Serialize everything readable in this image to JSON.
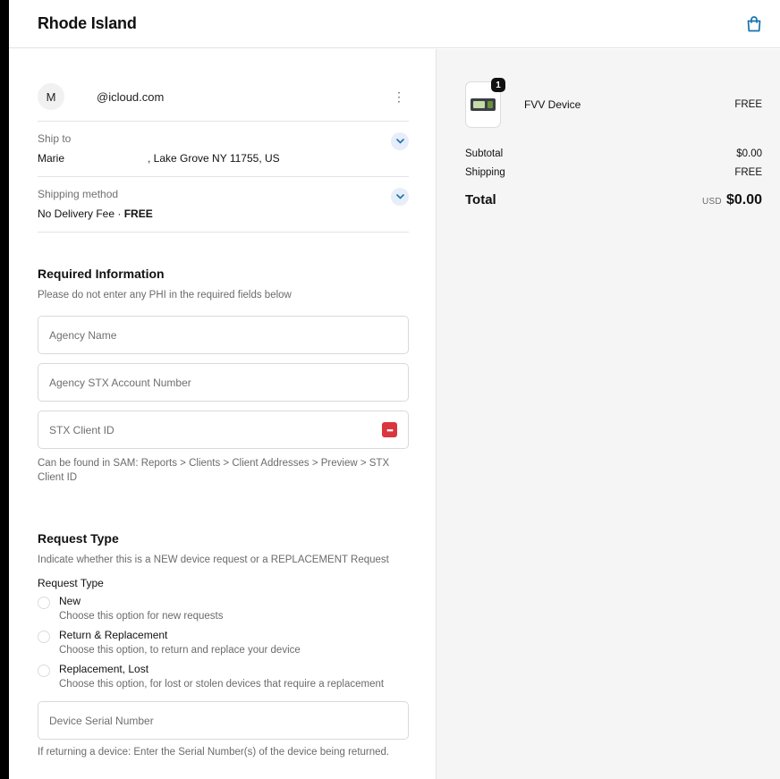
{
  "header": {
    "store_name": "Rhode Island",
    "cart_icon": "shopping-bag-icon"
  },
  "contact": {
    "avatar_initial": "M",
    "email": "@icloud.com",
    "menu_icon": "more-vertical-icon"
  },
  "ship_to": {
    "label": "Ship to",
    "name": "Marie",
    "address": ", Lake Grove NY 11755, US"
  },
  "shipping_method": {
    "label": "Shipping method",
    "value": "No Delivery Fee · ",
    "price": "FREE"
  },
  "required_info": {
    "title": "Required Information",
    "subtitle": "Please do not enter any PHI in the required fields below",
    "fields": [
      {
        "placeholder": "Agency Name"
      },
      {
        "placeholder": "Agency STX Account Number"
      },
      {
        "placeholder": "STX Client ID"
      }
    ],
    "client_id_help": "Can be found in SAM: Reports > Clients > Client Addresses > Preview > STX Client ID"
  },
  "request_type": {
    "title": "Request Type",
    "subtitle": "Indicate whether this is a NEW device request or a REPLACEMENT Request",
    "group_label": "Request Type",
    "options": [
      {
        "label": "New",
        "description": "Choose this option for new requests"
      },
      {
        "label": "Return & Replacement",
        "description": "Choose this option, to return and replace your device"
      },
      {
        "label": "Replacement, Lost",
        "description": "Choose this option, for lost or stolen devices that require a replacement"
      }
    ],
    "serial_placeholder": "Device Serial Number",
    "serial_help": "If returning a device: Enter the Serial Number(s) of the device being returned."
  },
  "summary": {
    "item": {
      "name": "FVV Device",
      "price": "FREE",
      "quantity": "1"
    },
    "subtotal_label": "Subtotal",
    "subtotal_value": "$0.00",
    "shipping_label": "Shipping",
    "shipping_value": "FREE",
    "total_label": "Total",
    "currency": "USD",
    "total_value": "$0.00"
  },
  "colors": {
    "accent": "#1773b0",
    "chevron_bg": "#e8eef9",
    "password_icon": "#d9363e"
  }
}
